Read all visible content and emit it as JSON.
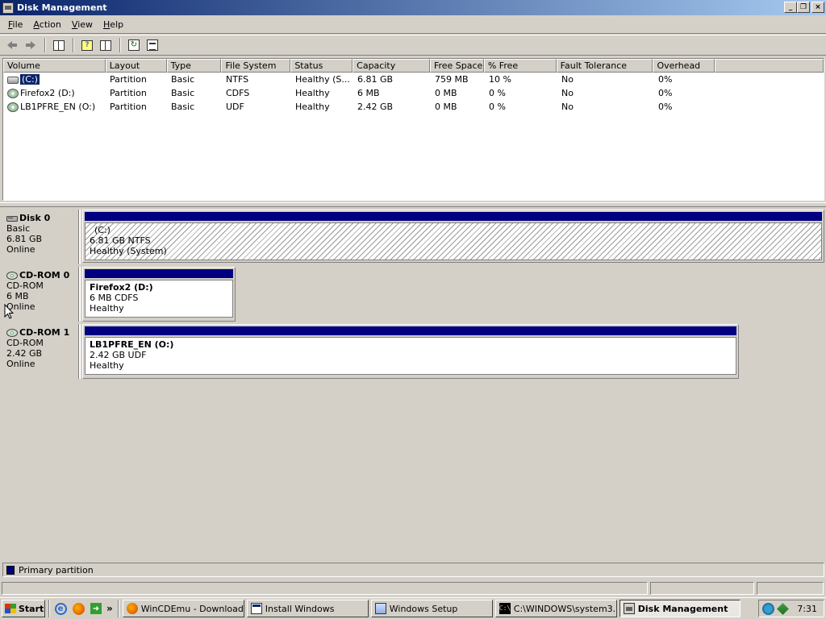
{
  "window": {
    "title": "Disk Management",
    "btn_minimize": "_",
    "btn_restore": "❐",
    "btn_close": "×"
  },
  "menu": {
    "file": {
      "u": "F",
      "rest": "ile"
    },
    "action": {
      "u": "A",
      "rest": "ction"
    },
    "view": {
      "u": "V",
      "rest": "iew"
    },
    "help": {
      "u": "H",
      "rest": "elp"
    }
  },
  "toolbar": {
    "back": "back-icon",
    "forward": "forward-icon"
  },
  "volume_list": {
    "columns": [
      "Volume",
      "Layout",
      "Type",
      "File System",
      "Status",
      "Capacity",
      "Free Space",
      "% Free",
      "Fault Tolerance",
      "Overhead"
    ],
    "rows": [
      {
        "volume": "(C:)",
        "layout": "Partition",
        "type": "Basic",
        "fs": "NTFS",
        "status": "Healthy (S...",
        "capacity": "6.81 GB",
        "free": "759 MB",
        "pct": "10 %",
        "fault": "No",
        "overhead": "0%",
        "icon": "hard-drive-icon"
      },
      {
        "volume": "Firefox2 (D:)",
        "layout": "Partition",
        "type": "Basic",
        "fs": "CDFS",
        "status": "Healthy",
        "capacity": "6 MB",
        "free": "0 MB",
        "pct": "0 %",
        "fault": "No",
        "overhead": "0%",
        "icon": "cd-drive-icon"
      },
      {
        "volume": "LB1PFRE_EN (O:)",
        "layout": "Partition",
        "type": "Basic",
        "fs": "UDF",
        "status": "Healthy",
        "capacity": "2.42 GB",
        "free": "0 MB",
        "pct": "0 %",
        "fault": "No",
        "overhead": "0%",
        "icon": "cd-drive-icon"
      }
    ]
  },
  "disks": [
    {
      "name": "Disk 0",
      "type": "Basic",
      "size": "6.81 GB",
      "state": "Online",
      "partition": {
        "name": "(C:)",
        "detail": "6.81 GB NTFS",
        "status": "Healthy (System)"
      }
    },
    {
      "name": "CD-ROM 0",
      "type": "CD-ROM",
      "size": "6 MB",
      "state": "Online",
      "partition": {
        "name": "Firefox2  (D:)",
        "detail": "6 MB CDFS",
        "status": "Healthy"
      }
    },
    {
      "name": "CD-ROM 1",
      "type": "CD-ROM",
      "size": "2.42 GB",
      "state": "Online",
      "partition": {
        "name": "LB1PFRE_EN  (O:)",
        "detail": "2.42 GB UDF",
        "status": "Healthy"
      }
    }
  ],
  "legend": {
    "primary": "Primary partition",
    "color": "#000080"
  },
  "taskbar": {
    "start": "Start",
    "more": "»",
    "tasks": [
      "WinCDEmu - Download...",
      "Install Windows",
      "Windows Setup",
      "C:\\WINDOWS\\system3...",
      "Disk Management"
    ],
    "clock": "7:31"
  },
  "colors": {
    "titlebar": "#0a246a",
    "partition_bar": "#000080",
    "chrome": "#d4d0c8"
  }
}
